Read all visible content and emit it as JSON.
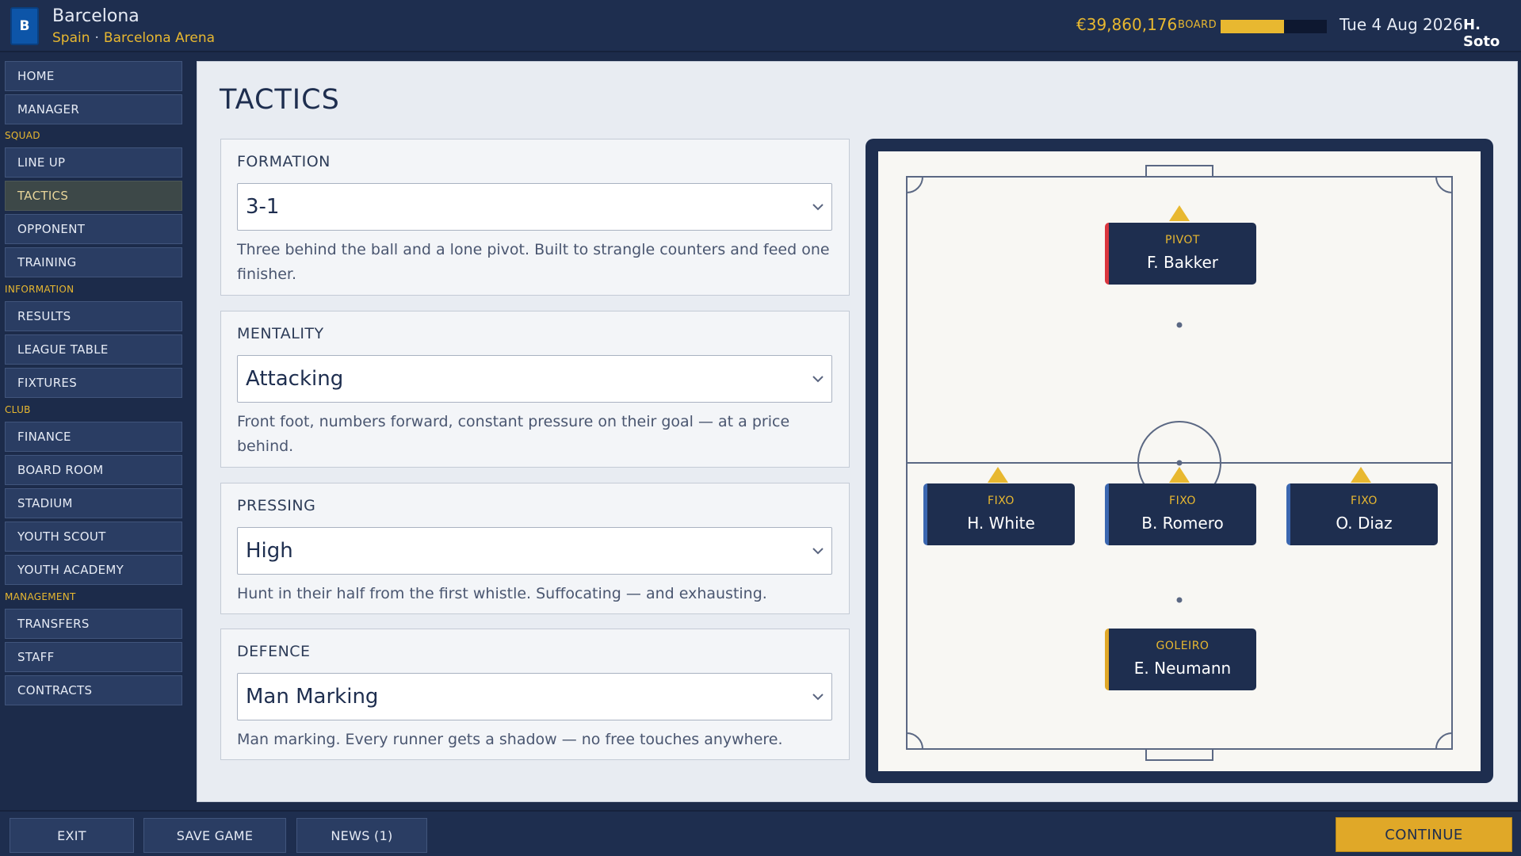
{
  "header": {
    "badge_letter": "B",
    "club_name": "Barcelona",
    "country": "Spain",
    "stadium": "Barcelona Arena",
    "balance": "€39,860,176",
    "board_label": "BOARD",
    "board_confidence": 0.6,
    "date": "Tue 4 Aug 2026",
    "manager": "H. Soto"
  },
  "sidebar": {
    "home": "HOME",
    "manager": "MANAGER",
    "sections": {
      "squad": "SQUAD",
      "information": "INFORMATION",
      "club": "CLUB",
      "management": "MANAGEMENT"
    },
    "items": {
      "line_up": "LINE UP",
      "tactics": "TACTICS",
      "opponent": "OPPONENT",
      "training": "TRAINING",
      "results": "RESULTS",
      "league_table": "LEAGUE TABLE",
      "fixtures": "FIXTURES",
      "finance": "FINANCE",
      "board_room": "BOARD ROOM",
      "stadium": "STADIUM",
      "youth_scout": "YOUTH SCOUT",
      "youth_academy": "YOUTH ACADEMY",
      "transfers": "TRANSFERS",
      "staff": "STAFF",
      "contracts": "CONTRACTS"
    }
  },
  "main": {
    "title": "TACTICS",
    "formation": {
      "label": "FORMATION",
      "value": "3-1",
      "desc": "Three behind the ball and a lone pivot. Built to strangle counters and feed one finisher."
    },
    "mentality": {
      "label": "MENTALITY",
      "value": "Attacking",
      "desc": "Front foot, numbers forward, constant pressure on their goal — at a price behind."
    },
    "pressing": {
      "label": "PRESSING",
      "value": "High",
      "desc": "Hunt in their half from the first whistle. Suffocating — and exhausting."
    },
    "defence": {
      "label": "DEFENCE",
      "value": "Man Marking",
      "desc": "Man marking. Every runner gets a shadow — no free touches anywhere."
    }
  },
  "pitch": {
    "players": {
      "pivot": {
        "role": "PIVOT",
        "name": "F. Bakker",
        "accent": "#d9363e"
      },
      "fixo_left": {
        "role": "FIXO",
        "name": "H. White",
        "accent": "#3b67b0"
      },
      "fixo_center": {
        "role": "FIXO",
        "name": "B. Romero",
        "accent": "#3b67b0"
      },
      "fixo_right": {
        "role": "FIXO",
        "name": "O. Diaz",
        "accent": "#3b67b0"
      },
      "goleiro": {
        "role": "GOLEIRO",
        "name": "E. Neumann",
        "accent": "#e0a828"
      }
    }
  },
  "footer": {
    "exit": "EXIT",
    "save": "SAVE GAME",
    "news": "NEWS (1)",
    "continue": "CONTINUE"
  },
  "colors": {
    "accent": "#e8b830",
    "navy": "#1e2e4f"
  }
}
